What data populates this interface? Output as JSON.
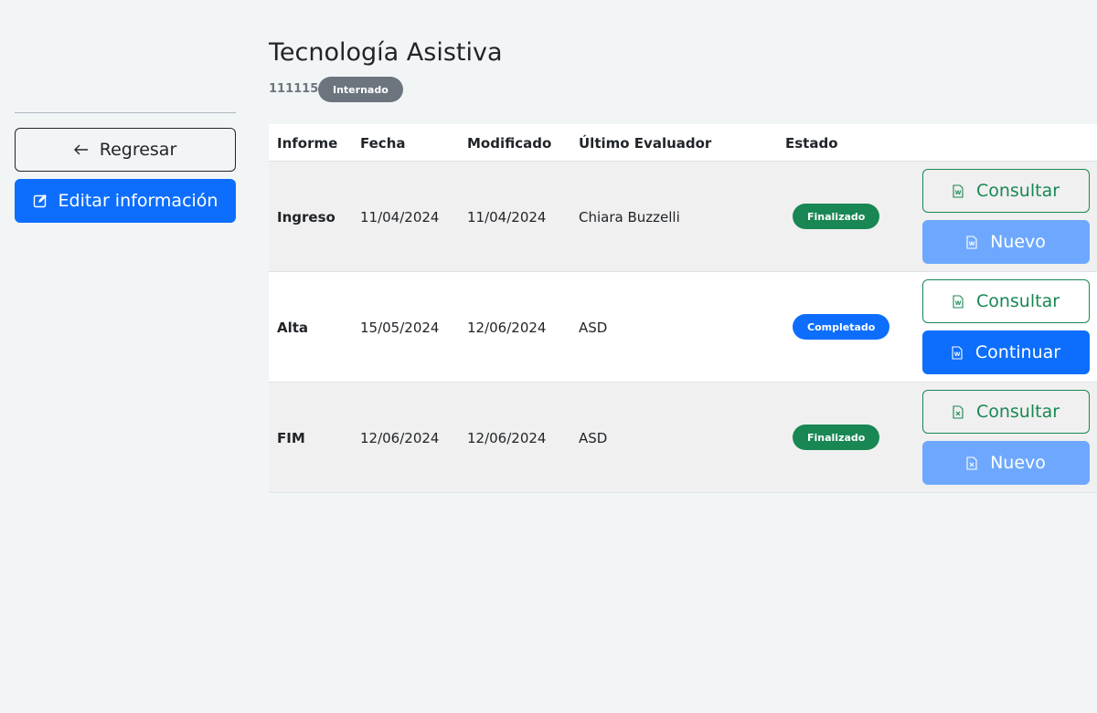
{
  "sidebar": {
    "back_label": "Regresar",
    "edit_label": "Editar información"
  },
  "header": {
    "title": "Tecnología Asistiva",
    "code": "111115",
    "status": "Internado"
  },
  "table": {
    "columns": [
      "Informe",
      "Fecha",
      "Modificado",
      "Último Evaluador",
      "Estado"
    ],
    "rows": [
      {
        "informe": "Ingreso",
        "fecha": "11/04/2024",
        "modificado": "11/04/2024",
        "evaluador": "Chiara Buzzelli",
        "estado": "Finalizado",
        "consult_label": "Consultar",
        "action_label": "Nuevo"
      },
      {
        "informe": "Alta",
        "fecha": "15/05/2024",
        "modificado": "12/06/2024",
        "evaluador": "ASD",
        "estado": "Completado",
        "consult_label": "Consultar",
        "action_label": "Continuar"
      },
      {
        "informe": "FIM",
        "fecha": "12/06/2024",
        "modificado": "12/06/2024",
        "evaluador": "ASD",
        "estado": "Finalizado",
        "consult_label": "Consultar",
        "action_label": "Nuevo"
      }
    ]
  },
  "colors": {
    "primary": "#0d6efd",
    "primary_light": "#6ea8fe",
    "success": "#198754",
    "secondary": "#6c757d",
    "background": "#f2f5f6"
  },
  "icons": {
    "back": "arrow-left-icon",
    "edit": "edit-square-icon",
    "word": "word-file-icon",
    "excel": "excel-file-icon"
  }
}
